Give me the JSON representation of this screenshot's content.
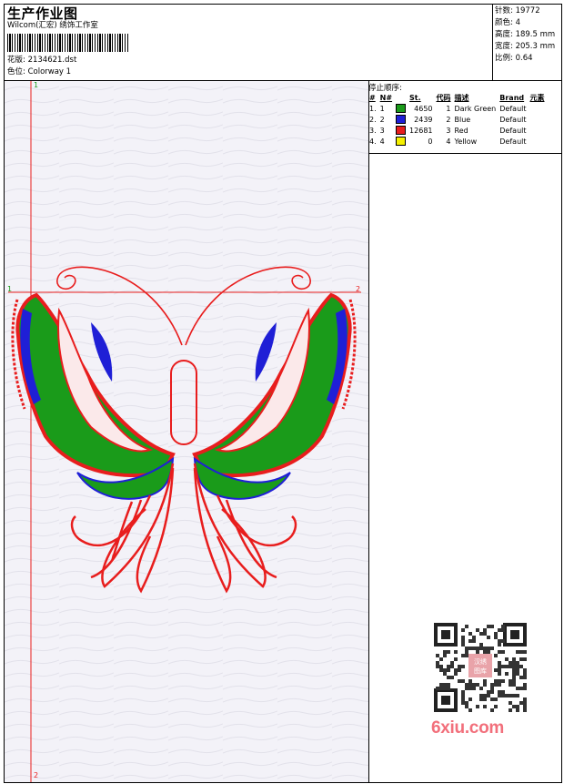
{
  "header": {
    "title": "生产作业图",
    "subtitle": "Wilcom(汇宏) 绣饰工作室",
    "design_label": "花版:",
    "design_value": "2134621.dst",
    "colorway_label": "色位:",
    "colorway_value": "Colorway 1"
  },
  "stats": {
    "stitches_label": "针数:",
    "stitches_value": "19772",
    "colors_label": "颜色:",
    "colors_value": "4",
    "height_label": "高度:",
    "height_value": "189.5 mm",
    "width_label": "宽度:",
    "width_value": "205.3 mm",
    "scale_label": "比例:",
    "scale_value": "0.64"
  },
  "stop_sequence": {
    "title": "停止顺序:",
    "headers": {
      "hash": "#",
      "n": "N#",
      "st": "St.",
      "code": "代码",
      "desc": "描述",
      "brand": "Brand",
      "elem": "元素"
    },
    "rows": [
      {
        "idx": "1.",
        "n": "1",
        "color": "#1a9b1a",
        "st": "4650",
        "code": "1",
        "desc": "Dark Green",
        "brand": "Default"
      },
      {
        "idx": "2.",
        "n": "2",
        "color": "#1f1fd6",
        "st": "2439",
        "code": "2",
        "desc": "Blue",
        "brand": "Default"
      },
      {
        "idx": "3.",
        "n": "3",
        "color": "#e81d1d",
        "st": "12681",
        "code": "3",
        "desc": "Red",
        "brand": "Default"
      },
      {
        "idx": "4.",
        "n": "4",
        "color": "#f5f000",
        "st": "0",
        "code": "4",
        "desc": "Yellow",
        "brand": "Default"
      }
    ]
  },
  "canvas": {
    "marker_top": "1",
    "marker_left": "1",
    "marker_right": "2",
    "marker_bottom": "2"
  },
  "watermark": {
    "logo_text": "6xiu.com",
    "seal_text": "汉绣图库"
  },
  "colors": {
    "red": "#e81d1d",
    "green": "#1a9b1a",
    "blue": "#1f1fd6",
    "yellow": "#f5f000",
    "canvas_bg": "#f3f2f8"
  }
}
